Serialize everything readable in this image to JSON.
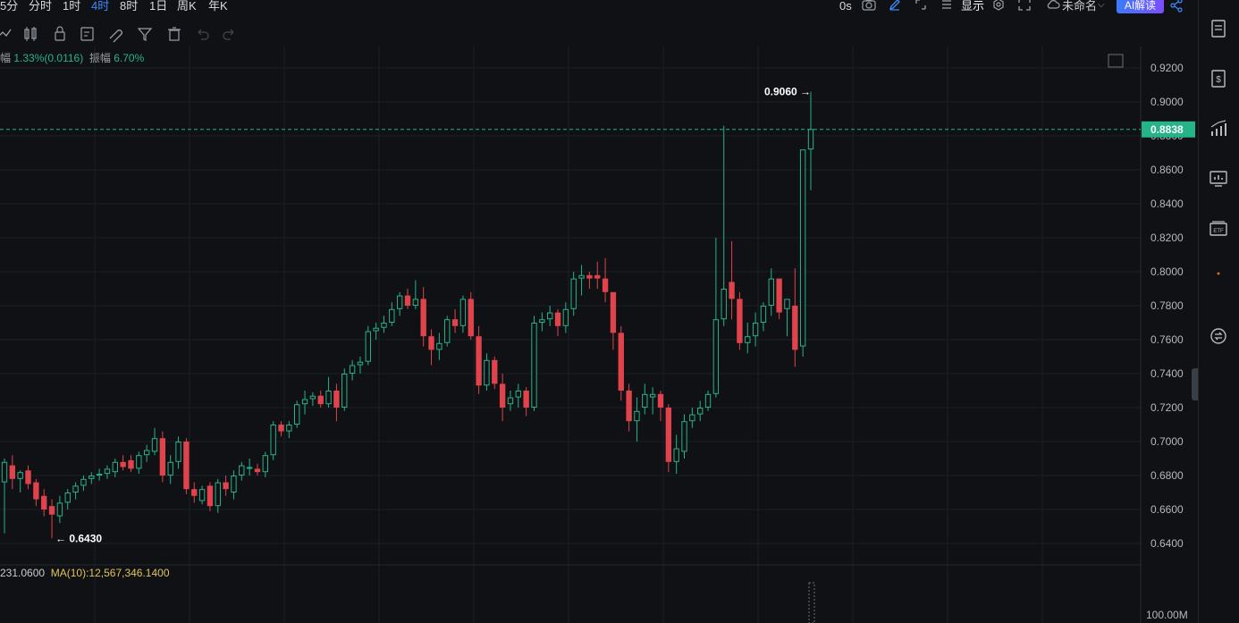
{
  "toolbar": {
    "timeframes": [
      "5分",
      "分时",
      "1时",
      "4时",
      "8时",
      "1日",
      "周K",
      "年K"
    ],
    "active_timeframe": "4时",
    "countdown": "0s",
    "display_label": "显示",
    "layout_name": "未命名",
    "ai_label": "AI解读"
  },
  "info_bar": {
    "change_label": "幅",
    "change_value": "1.33%(0.0116)",
    "amplitude_label": "振幅",
    "amplitude_value": "6.70%"
  },
  "volume_bar": {
    "base_value": "231.0600",
    "ma_label": "MA(10):12,567,346.1400"
  },
  "colors": {
    "up": "#26b38a",
    "down": "#e0434b",
    "background": "#0f1114",
    "price_tag": "#26b38a",
    "ma_text": "#e0c35a"
  },
  "chart_data": {
    "type": "candlestick",
    "y_axis_ticks": [
      "0.9200",
      "0.9000",
      "0.8800",
      "0.8600",
      "0.8400",
      "0.8200",
      "0.8000",
      "0.7800",
      "0.7600",
      "0.7400",
      "0.7200",
      "0.7000",
      "0.6800",
      "0.6600",
      "0.6400"
    ],
    "ylim": [
      0.63,
      0.927
    ],
    "current_price": "0.8838",
    "high_label": "0.9060",
    "low_label": "0.6430",
    "volume_axis_label": "100.00M",
    "candles": [
      [
        0.676,
        0.69,
        0.646,
        0.688
      ],
      [
        0.686,
        0.692,
        0.672,
        0.678
      ],
      [
        0.678,
        0.683,
        0.67,
        0.682
      ],
      [
        0.683,
        0.686,
        0.672,
        0.675
      ],
      [
        0.676,
        0.678,
        0.662,
        0.666
      ],
      [
        0.668,
        0.672,
        0.656,
        0.66
      ],
      [
        0.662,
        0.666,
        0.643,
        0.657
      ],
      [
        0.656,
        0.668,
        0.652,
        0.664
      ],
      [
        0.664,
        0.672,
        0.66,
        0.67
      ],
      [
        0.67,
        0.676,
        0.666,
        0.674
      ],
      [
        0.674,
        0.68,
        0.671,
        0.678
      ],
      [
        0.678,
        0.682,
        0.675,
        0.68
      ],
      [
        0.68,
        0.684,
        0.677,
        0.681
      ],
      [
        0.681,
        0.686,
        0.678,
        0.684
      ],
      [
        0.682,
        0.69,
        0.679,
        0.688
      ],
      [
        0.688,
        0.692,
        0.683,
        0.685
      ],
      [
        0.689,
        0.692,
        0.682,
        0.684
      ],
      [
        0.684,
        0.694,
        0.681,
        0.692
      ],
      [
        0.692,
        0.698,
        0.688,
        0.695
      ],
      [
        0.694,
        0.708,
        0.692,
        0.702
      ],
      [
        0.702,
        0.706,
        0.676,
        0.68
      ],
      [
        0.68,
        0.692,
        0.675,
        0.688
      ],
      [
        0.688,
        0.703,
        0.684,
        0.7
      ],
      [
        0.7,
        0.702,
        0.669,
        0.672
      ],
      [
        0.672,
        0.676,
        0.664,
        0.668
      ],
      [
        0.665,
        0.674,
        0.663,
        0.672
      ],
      [
        0.674,
        0.676,
        0.659,
        0.662
      ],
      [
        0.662,
        0.678,
        0.658,
        0.676
      ],
      [
        0.676,
        0.68,
        0.668,
        0.672
      ],
      [
        0.67,
        0.683,
        0.666,
        0.68
      ],
      [
        0.68,
        0.688,
        0.677,
        0.686
      ],
      [
        0.684,
        0.69,
        0.68,
        0.685
      ],
      [
        0.684,
        0.687,
        0.68,
        0.682
      ],
      [
        0.682,
        0.694,
        0.679,
        0.692
      ],
      [
        0.692,
        0.712,
        0.689,
        0.71
      ],
      [
        0.71,
        0.712,
        0.703,
        0.706
      ],
      [
        0.706,
        0.712,
        0.702,
        0.71
      ],
      [
        0.71,
        0.724,
        0.708,
        0.722
      ],
      [
        0.722,
        0.73,
        0.716,
        0.725
      ],
      [
        0.725,
        0.729,
        0.721,
        0.727
      ],
      [
        0.727,
        0.73,
        0.72,
        0.722
      ],
      [
        0.722,
        0.738,
        0.72,
        0.73
      ],
      [
        0.73,
        0.734,
        0.712,
        0.72
      ],
      [
        0.72,
        0.743,
        0.718,
        0.74
      ],
      [
        0.74,
        0.748,
        0.736,
        0.745
      ],
      [
        0.745,
        0.75,
        0.74,
        0.747
      ],
      [
        0.747,
        0.768,
        0.745,
        0.765
      ],
      [
        0.765,
        0.77,
        0.76,
        0.767
      ],
      [
        0.767,
        0.774,
        0.764,
        0.77
      ],
      [
        0.77,
        0.782,
        0.768,
        0.778
      ],
      [
        0.778,
        0.788,
        0.774,
        0.786
      ],
      [
        0.786,
        0.79,
        0.778,
        0.78
      ],
      [
        0.78,
        0.795,
        0.778,
        0.784
      ],
      [
        0.784,
        0.791,
        0.756,
        0.762
      ],
      [
        0.762,
        0.766,
        0.745,
        0.754
      ],
      [
        0.754,
        0.764,
        0.748,
        0.758
      ],
      [
        0.758,
        0.774,
        0.756,
        0.772
      ],
      [
        0.772,
        0.778,
        0.764,
        0.768
      ],
      [
        0.768,
        0.786,
        0.764,
        0.784
      ],
      [
        0.784,
        0.788,
        0.76,
        0.762
      ],
      [
        0.762,
        0.768,
        0.728,
        0.733
      ],
      [
        0.733,
        0.752,
        0.73,
        0.748
      ],
      [
        0.748,
        0.75,
        0.731,
        0.734
      ],
      [
        0.734,
        0.74,
        0.712,
        0.72
      ],
      [
        0.722,
        0.73,
        0.718,
        0.726
      ],
      [
        0.726,
        0.734,
        0.72,
        0.73
      ],
      [
        0.73,
        0.732,
        0.715,
        0.72
      ],
      [
        0.72,
        0.774,
        0.718,
        0.77
      ],
      [
        0.77,
        0.776,
        0.765,
        0.772
      ],
      [
        0.772,
        0.78,
        0.768,
        0.776
      ],
      [
        0.776,
        0.778,
        0.762,
        0.768
      ],
      [
        0.768,
        0.782,
        0.764,
        0.778
      ],
      [
        0.778,
        0.8,
        0.774,
        0.796
      ],
      [
        0.796,
        0.804,
        0.786,
        0.798
      ],
      [
        0.798,
        0.8,
        0.79,
        0.796
      ],
      [
        0.798,
        0.806,
        0.79,
        0.796
      ],
      [
        0.796,
        0.808,
        0.782,
        0.788
      ],
      [
        0.788,
        0.786,
        0.754,
        0.764
      ],
      [
        0.764,
        0.768,
        0.724,
        0.73
      ],
      [
        0.73,
        0.734,
        0.706,
        0.712
      ],
      [
        0.712,
        0.726,
        0.7,
        0.718
      ],
      [
        0.72,
        0.734,
        0.716,
        0.728
      ],
      [
        0.726,
        0.732,
        0.716,
        0.728
      ],
      [
        0.728,
        0.73,
        0.712,
        0.72
      ],
      [
        0.72,
        0.722,
        0.682,
        0.688
      ],
      [
        0.688,
        0.704,
        0.681,
        0.696
      ],
      [
        0.694,
        0.716,
        0.69,
        0.712
      ],
      [
        0.712,
        0.72,
        0.708,
        0.716
      ],
      [
        0.716,
        0.724,
        0.712,
        0.72
      ],
      [
        0.72,
        0.73,
        0.718,
        0.728
      ],
      [
        0.728,
        0.82,
        0.726,
        0.772
      ],
      [
        0.772,
        0.886,
        0.768,
        0.79
      ],
      [
        0.794,
        0.818,
        0.772,
        0.784
      ],
      [
        0.784,
        0.788,
        0.754,
        0.758
      ],
      [
        0.758,
        0.77,
        0.752,
        0.762
      ],
      [
        0.762,
        0.776,
        0.756,
        0.77
      ],
      [
        0.77,
        0.782,
        0.765,
        0.78
      ],
      [
        0.78,
        0.802,
        0.774,
        0.796
      ],
      [
        0.796,
        0.794,
        0.772,
        0.776
      ],
      [
        0.778,
        0.782,
        0.762,
        0.784
      ],
      [
        0.78,
        0.802,
        0.744,
        0.754
      ],
      [
        0.756,
        0.87,
        0.75,
        0.872
      ],
      [
        0.872,
        0.906,
        0.848,
        0.884
      ]
    ]
  }
}
